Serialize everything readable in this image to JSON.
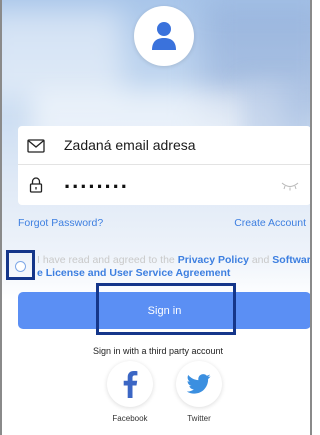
{
  "login": {
    "email_value": "Zadaná email adresa",
    "password_value": "........",
    "forgot_password": "Forgot Password?",
    "create_account": "Create Account",
    "agreement_prefix": "I have read and agreed to the",
    "privacy_policy": "Privacy Policy",
    "agreement_and": "and",
    "software_license_part1": "Softwar",
    "software_license_part2": "e License and User Service Agreement",
    "signin_label": "Sign in",
    "third_party_label": "Sign in with a third party account"
  },
  "social": [
    {
      "label": "Facebook",
      "icon": "facebook-icon"
    },
    {
      "label": "Twitter",
      "icon": "twitter-icon"
    }
  ],
  "colors": {
    "accent": "#5b8ff4",
    "link": "#3d7fe0",
    "highlight_box": "#15368a",
    "facebook": "#3b66c4",
    "twitter": "#3b8fe0"
  }
}
